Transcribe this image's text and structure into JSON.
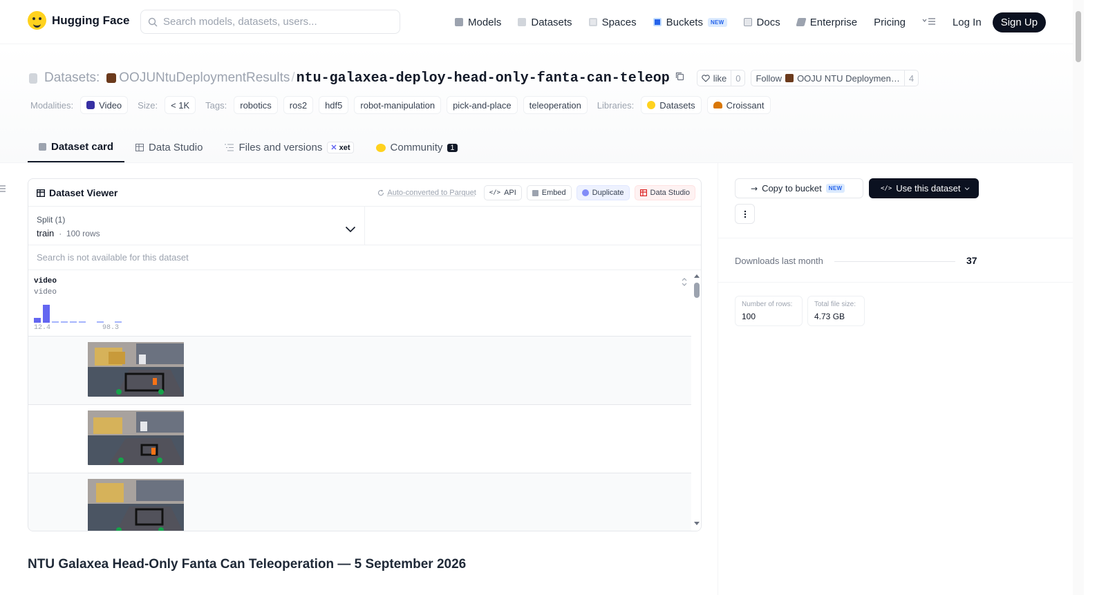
{
  "nav": {
    "brand": "Hugging Face",
    "search_placeholder": "Search models, datasets, users...",
    "links": {
      "models": "Models",
      "datasets": "Datasets",
      "spaces": "Spaces",
      "buckets": "Buckets",
      "buckets_badge": "NEW",
      "docs": "Docs",
      "enterprise": "Enterprise",
      "pricing": "Pricing"
    },
    "login": "Log In",
    "signup": "Sign Up"
  },
  "header": {
    "crumb_label": "Datasets:",
    "org": "OOJUNtuDeploymentResults",
    "separator": "/",
    "repo": "ntu-galaxea-deploy-head-only-fanta-can-teleop",
    "like_label": "like",
    "like_count": "0",
    "follow_label": "Follow",
    "follow_org": "OOJU NTU Deploymen…",
    "follow_count": "4"
  },
  "tags": {
    "modalities_label": "Modalities:",
    "modality": "Video",
    "size_label": "Size:",
    "size": "< 1K",
    "tags_label": "Tags:",
    "items": [
      "robotics",
      "ros2",
      "hdf5",
      "robot-manipulation",
      "pick-and-place",
      "teleoperation"
    ],
    "libraries_label": "Libraries:",
    "libraries": [
      "Datasets",
      "Croissant"
    ]
  },
  "tabs": {
    "card": "Dataset card",
    "studio": "Data Studio",
    "files": "Files and versions",
    "xet": "xet",
    "community": "Community",
    "community_count": "1"
  },
  "viewer": {
    "title": "Dataset Viewer",
    "auto_converted": "Auto-converted to Parquet",
    "api": "API",
    "embed": "Embed",
    "duplicate": "Duplicate",
    "data_studio": "Data Studio",
    "split_title": "Split (1)",
    "split_name": "train",
    "split_rows": "100 rows",
    "search_na": "Search is not available for this dataset",
    "column_name": "video",
    "column_type": "video",
    "hist_min": "12.4",
    "hist_max": "98.3"
  },
  "readme": {
    "heading": "NTU Galaxea Head-Only Fanta Can Teleoperation — 5 September 2026"
  },
  "sidebar": {
    "copy_bucket": "Copy to bucket",
    "copy_badge": "NEW",
    "use_dataset": "Use this dataset",
    "downloads_label": "Downloads last month",
    "downloads_value": "37",
    "rows_label": "Number of rows:",
    "rows_value": "100",
    "filesize_label": "Total file size:",
    "filesize_value": "4.73 GB"
  },
  "colors": {
    "accent_dark": "#0b1120",
    "hist_bar": "#6366f1",
    "brand_yellow": "#FFD21E"
  }
}
